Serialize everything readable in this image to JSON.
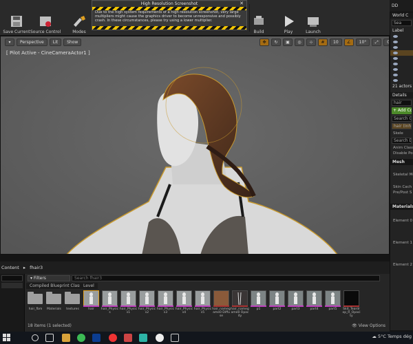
{
  "toolbar": {
    "save_current": "Save Current",
    "source_control": "Source Control",
    "modes": "Modes",
    "build": "Build",
    "play": "Play",
    "launch": "Launch"
  },
  "popup": {
    "title": "High Resolution Screenshot",
    "message": "Due to the high system requirements of a high resolution screenshot, very large multipliers might cause the graphics driver to become unresponsive and possibly crash. In these circumstances, please try using a lower multiplier."
  },
  "viewport": {
    "perspective": "Perspective",
    "lit": "Lit",
    "show": "Show",
    "pilot": "[ Pilot Active - CineCameraActor1 ]",
    "grid_snap": "10",
    "rot_snap": "10°",
    "scale_snap": "0,25",
    "cam_speed": "1"
  },
  "topright": {
    "label": "DD"
  },
  "right": {
    "world_title": "World C",
    "search_placeholder": "Sea",
    "label_col": "Label",
    "actors_count": "21 actors",
    "details_title": "Details",
    "details_search": "hair",
    "add_component": "+ Add Co",
    "search_components": "Search C",
    "hair_component": "hair (Inh",
    "skeletal": "Skele",
    "search_details": "Search D",
    "anim_class": "Anim Class",
    "disable_post": "Disable Po",
    "mesh_cat": "Mesh",
    "skeletal_mesh": "Skeletal Me",
    "skin_cache": "Skin Cach",
    "pre_post": "Pre/Post S",
    "materials_cat": "Materials",
    "element0": "Element 0",
    "element1": "Element 1",
    "element2": "Element 2"
  },
  "content_browser": {
    "tab_label": "Content",
    "path": "fhair3",
    "filters": "Filters",
    "search_placeholder": "Search fhair3",
    "compiled_blueprint_class": "Compiled Blueprint Class",
    "level": "Level",
    "footer": "18 items (1 selected)",
    "view_options": "View Options",
    "assets": [
      {
        "name": "hair_fbm",
        "kind": "folder",
        "bar": ""
      },
      {
        "name": "Materials",
        "kind": "folder",
        "bar": ""
      },
      {
        "name": "textures",
        "kind": "folder",
        "bar": ""
      },
      {
        "name": "hair",
        "kind": "physics",
        "bar": "#c040c0",
        "selected": true
      },
      {
        "name": "hair_Physics",
        "kind": "physics",
        "bar": "#c040c0"
      },
      {
        "name": "hair_Physics1",
        "kind": "physics",
        "bar": "#c040c0"
      },
      {
        "name": "hair_Physics2",
        "kind": "physics",
        "bar": "#c040c0"
      },
      {
        "name": "hair_Physics3",
        "kind": "physics",
        "bar": "#c040c0"
      },
      {
        "name": "hair_Physics4",
        "kind": "physics",
        "bar": "#c040c0"
      },
      {
        "name": "hair_Physics5",
        "kind": "physics",
        "bar": "#c040c0"
      },
      {
        "name": "hair_namegame0 Diffuse",
        "kind": "texture-brown",
        "bar": "#a33"
      },
      {
        "name": "hair_namegame0 Opacity",
        "kind": "texture-dark",
        "bar": "#a33"
      },
      {
        "name": "p1",
        "kind": "mesh",
        "bar": "#c040c0"
      },
      {
        "name": "part2",
        "kind": "mesh",
        "bar": "#c040c0"
      },
      {
        "name": "part3",
        "kind": "mesh",
        "bar": "#c040c0"
      },
      {
        "name": "part4",
        "kind": "mesh",
        "bar": "#c040c0"
      },
      {
        "name": "part5",
        "kind": "mesh",
        "bar": "#c040c0"
      },
      {
        "name": "Skit_Teardrop_R_Opacity",
        "kind": "texture-black",
        "bar": "#a33"
      }
    ]
  },
  "taskbar": {
    "temp": "5°C",
    "weather": "Temps dég"
  },
  "colors": {
    "accent_orange": "#e0a020",
    "selection_gold": "#c99a2e",
    "add_green": "#4d8a2a"
  }
}
